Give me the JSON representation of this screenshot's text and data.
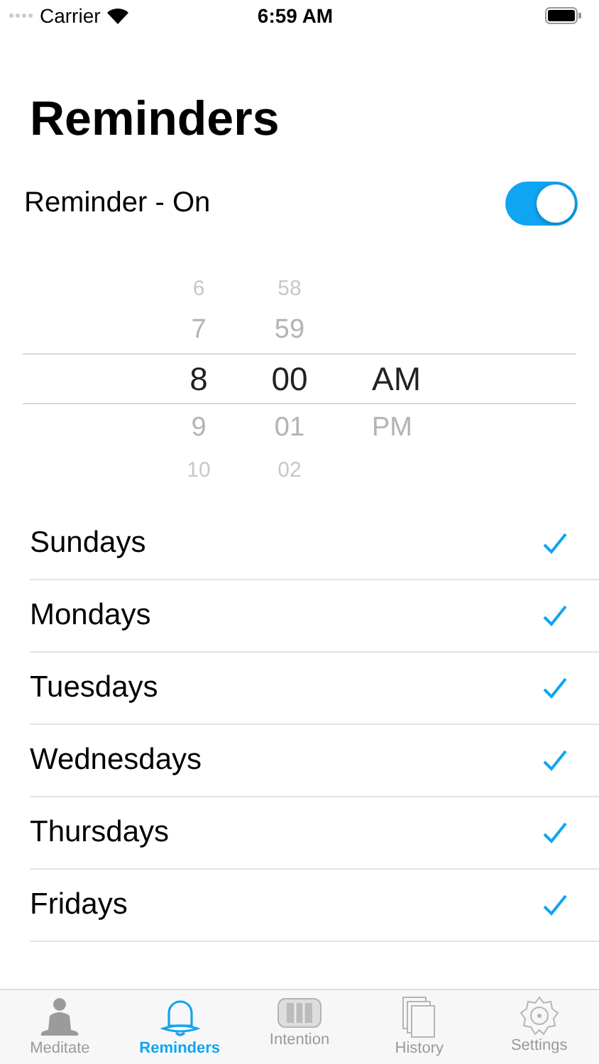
{
  "status_bar": {
    "carrier": "Carrier",
    "time": "6:59 AM"
  },
  "title": "Reminders",
  "reminder": {
    "label": "Reminder - On",
    "on": true
  },
  "picker": {
    "rows": [
      {
        "hour": "6",
        "minute": "58",
        "selected": false
      },
      {
        "hour": "7",
        "minute": "59",
        "selected": false
      },
      {
        "hour": "8",
        "minute": "00",
        "period": "AM",
        "selected": true
      },
      {
        "hour": "9",
        "minute": "01",
        "period": "PM",
        "selected": false
      },
      {
        "hour": "10",
        "minute": "02",
        "selected": false
      }
    ]
  },
  "days": [
    {
      "label": "Sundays",
      "checked": true
    },
    {
      "label": "Mondays",
      "checked": true
    },
    {
      "label": "Tuesdays",
      "checked": true
    },
    {
      "label": "Wednesdays",
      "checked": true
    },
    {
      "label": "Thursdays",
      "checked": true
    },
    {
      "label": "Fridays",
      "checked": true
    }
  ],
  "tabs": [
    {
      "kind": "meditate",
      "label": "Meditate",
      "selected": false
    },
    {
      "kind": "bell",
      "label": "Reminders",
      "selected": true
    },
    {
      "kind": "intention",
      "label": "Intention",
      "selected": false
    },
    {
      "kind": "history",
      "label": "History",
      "selected": false
    },
    {
      "kind": "settings",
      "label": "Settings",
      "selected": false
    }
  ]
}
